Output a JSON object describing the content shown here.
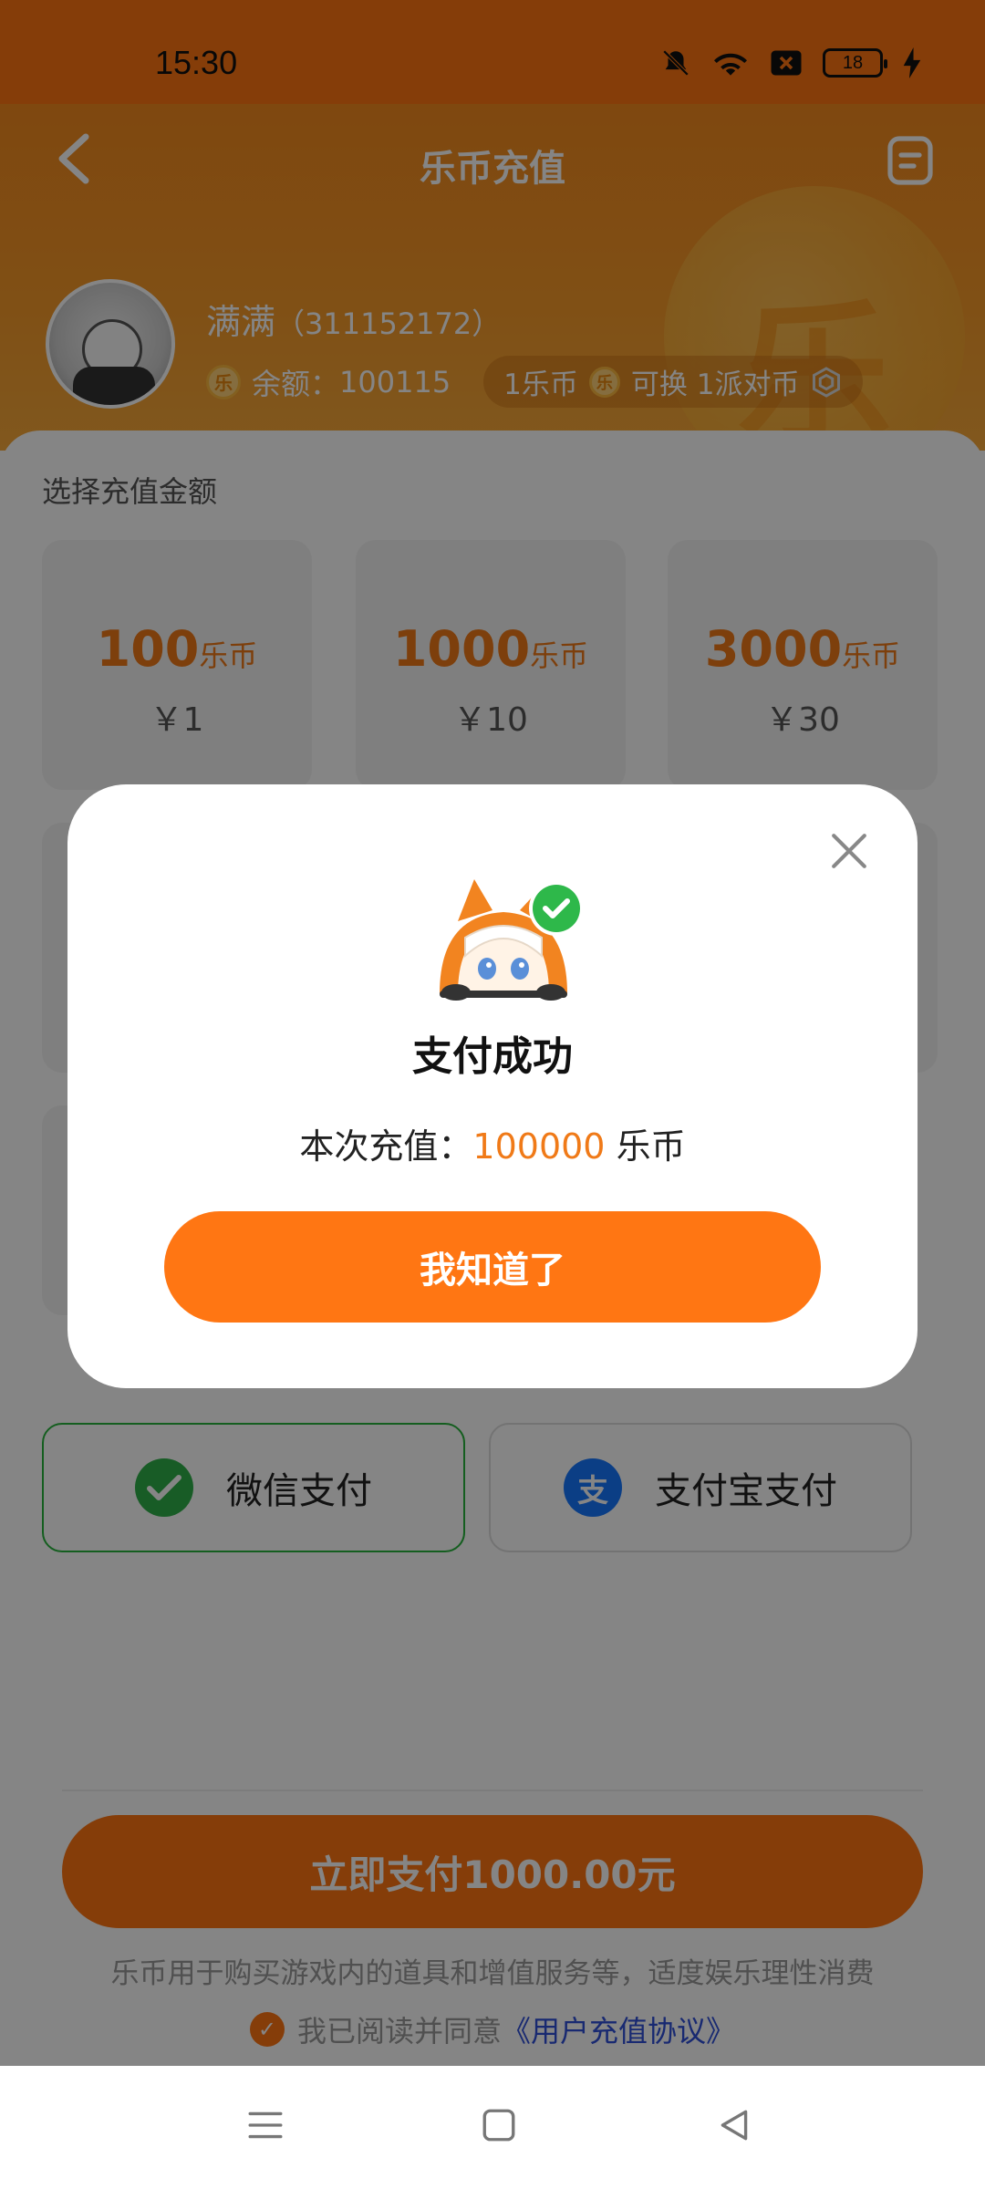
{
  "status_bar": {
    "time": "15:30",
    "battery": "18",
    "icons": [
      "bell-off-icon",
      "wifi-icon",
      "sim-off-icon",
      "battery-icon",
      "charging-icon"
    ]
  },
  "header": {
    "title": "乐币充值",
    "coin_glyph": "乐",
    "user": {
      "name": "满满",
      "id": "（311152172）",
      "balance_label": "余额：",
      "balance": "100115"
    },
    "exchange": {
      "left": "1乐币",
      "middle": "可换 1派对币"
    }
  },
  "main": {
    "section_label": "选择充值金额",
    "packages": [
      {
        "amount": "100",
        "unit": "乐币",
        "price": "￥1"
      },
      {
        "amount": "1000",
        "unit": "乐币",
        "price": "￥10"
      },
      {
        "amount": "3000",
        "unit": "乐币",
        "price": "￥30"
      }
    ],
    "payment_methods": [
      {
        "label": "微信支付",
        "icon": "wechat-pay-icon",
        "selected": true,
        "color": "#2FB14A"
      },
      {
        "label": "支付宝支付",
        "icon": "alipay-icon",
        "selected": false,
        "color": "#1677FF"
      }
    ],
    "pay_button": "立即支付1000.00元",
    "disclaimer": "乐币用于购买游戏内的道具和增值服务等，适度娱乐理性消费",
    "agreement": {
      "prefix": "我已阅读并同意",
      "link": "《用户充值协议》"
    }
  },
  "dialog": {
    "title": "支付成功",
    "line_prefix": "本次充值：",
    "amount": "100000",
    "unit": "乐币",
    "button": "我知道了"
  },
  "nav": {
    "icons": [
      "menu-icon",
      "home-icon",
      "back-icon"
    ]
  },
  "colors": {
    "accent": "#FF7613",
    "amount_text": "#F07A18",
    "link": "#2F4FD8",
    "success": "#28B43C"
  }
}
